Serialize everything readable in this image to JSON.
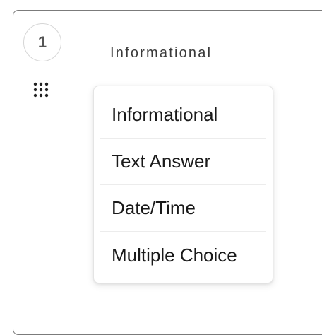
{
  "step": {
    "number": "1"
  },
  "question_type": {
    "selected_label": "Informational"
  },
  "dropdown": {
    "options": [
      {
        "label": "Informational"
      },
      {
        "label": "Text Answer"
      },
      {
        "label": "Date/Time"
      },
      {
        "label": "Multiple Choice"
      }
    ]
  },
  "icons": {
    "drag_handle": "grid-dots-icon"
  },
  "colors": {
    "card_border": "#7b7b7b",
    "circle_border": "#d6d6d6",
    "text_primary": "#1a1a1a",
    "text_muted": "#555555",
    "divider": "#ececec"
  }
}
